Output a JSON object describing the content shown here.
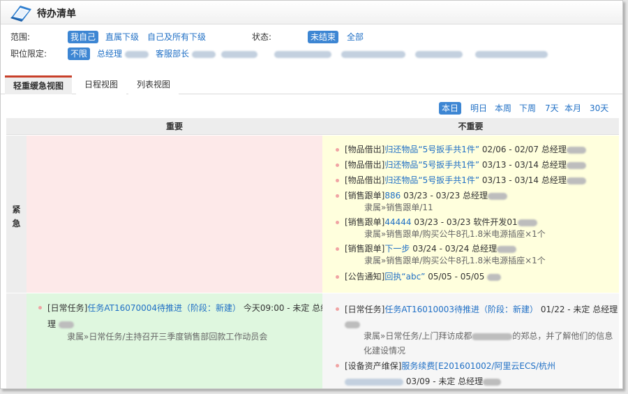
{
  "window": {
    "title": "待办清单"
  },
  "filters": {
    "scope_label": "范围:",
    "scope_options": [
      "我自己",
      "直属下级",
      "自己及所有下级"
    ],
    "status_label": "状态:",
    "status_options": [
      "未结束",
      "全部"
    ],
    "position_label": "职位限定:",
    "position_options": [
      "不限",
      "总经理",
      "客服部长"
    ]
  },
  "tabs": [
    "轻重缓急视图",
    "日程视图",
    "列表视图"
  ],
  "periods": [
    "本日",
    "明日",
    "本周",
    "下周",
    "7天",
    "本月",
    "30天"
  ],
  "grid": {
    "col_important": "重要",
    "col_not_important": "不重要",
    "row_urgent": "紧急"
  },
  "urgent_not_important": [
    {
      "tag": "[物品借出]",
      "title": "归还物品“5号扳手共1件”",
      "meta": " 02/06 - 02/07 总经理"
    },
    {
      "tag": "[物品借出]",
      "title": "归还物品“5号扳手共1件”",
      "meta": " 03/13 - 03/14 总经理"
    },
    {
      "tag": "[物品借出]",
      "title": "归还物品“5号扳手共1件”",
      "meta": " 03/13 - 03/14 总经理"
    },
    {
      "tag": "[销售跟单]",
      "title": "886",
      "meta": " 03/23 - 03/23 总经理",
      "sub": "隶属»销售跟单/11"
    },
    {
      "tag": "[销售跟单]",
      "title": "44444",
      "meta": " 03/23 - 03/23 软件开发01",
      "sub": "隶属»销售跟单/购买公牛8孔1.8米电源插座×1个"
    },
    {
      "tag": "[销售跟单]",
      "title": "下一步",
      "meta": " 03/24 - 03/24 总经理",
      "sub": "隶属»销售跟单/购买公牛8孔1.8米电源插座×1个"
    },
    {
      "tag": "[公告通知]",
      "title": "回执“abc”",
      "meta": " 05/05 - 05/05"
    }
  ],
  "not_urgent_important": [
    {
      "tag": "[日常任务]",
      "title": "任务AT16070004待推进（阶段：新建）",
      "meta": " 今天09:00 - 未定 总经",
      "meta2": "理",
      "sub": "隶属»日常任务/主持召开三季度销售部回款工作动员会"
    }
  ],
  "not_urgent_not_important": [
    {
      "tag": "[日常任务]",
      "title": "任务AT16010003待推进（阶段：新建）",
      "meta": " 01/22 - 未定 总经理",
      "sub1": "隶属»日常任务/上门拜访成都",
      "sub2": "的郑总，并了解他们的信息",
      "sub3": "化建设情况"
    },
    {
      "tag": "[设备资产维保]",
      "title": "服务续费",
      "title2": "[E201601002/阿里云ECS/杭州",
      "meta": " 03/09 - 未定 总经理"
    }
  ],
  "colors": {
    "urgent_important_bg": "#fde9e9",
    "urgent_not_important_bg": "#ffffdd",
    "not_urgent_important_bg": "#dff7df",
    "not_urgent_not_important_bg": "#f6f6f6",
    "link": "#1f6fc5",
    "selected": "#3d86d3",
    "active_tab_accent": "#c8402a"
  }
}
